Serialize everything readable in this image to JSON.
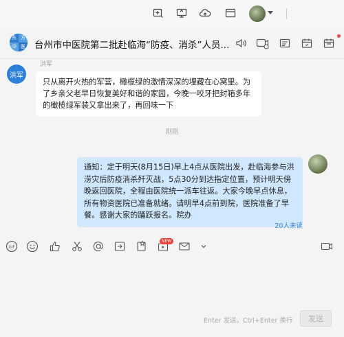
{
  "topbar": {
    "icons": [
      "add-window-icon",
      "screen-share-icon",
      "cloud-upload-icon",
      "window-icon"
    ]
  },
  "chat": {
    "title": "台州市中医院第二批赴临海“防疫、消杀”人员...",
    "group_avatar_chars": [
      "东",
      "方",
      "中",
      "医"
    ],
    "header_icons": [
      "microphone-icon",
      "video-call-icon",
      "file-icon",
      "calendar-icon"
    ]
  },
  "messages": [
    {
      "sender": "洪军",
      "avatar_label": "洪军",
      "text": "只从离开火热的军营，橄榄绿的激情深深的埋藏在心窝里。为了乡亲父老早日恢复美好和谐的家园，今晚一咬牙把封箱多年的橄榄绿军装又拿出来了，再回味一下"
    },
    {
      "timestamp": "刚刚"
    },
    {
      "sender": "me",
      "text": "通知：定于明天(8月15日)早上4点从医院出发，赴临海参与洪涝灾后防疫消杀歼灭战，5点30分到达指定位置，预计明天傍晚返回医院，全程由医院统一派车往返。大家今晚早点休息，所有物资医院已准备就绪。请明早4点前到院，医院准备了早餐。感谢大家的踊跃报名。院办",
      "unread": "20人未读"
    }
  ],
  "toolbar": {
    "gif_label": "GIF",
    "new_badge": "NEW"
  },
  "input": {
    "hint": "Enter 发送，Ctrl+Enter 换行",
    "send_label": "发送"
  },
  "colors": {
    "outgoing_bubble": "#cfe7ff",
    "incoming_bubble": "#ffffff",
    "unread": "#3a87d8",
    "badge": "#f44336"
  }
}
